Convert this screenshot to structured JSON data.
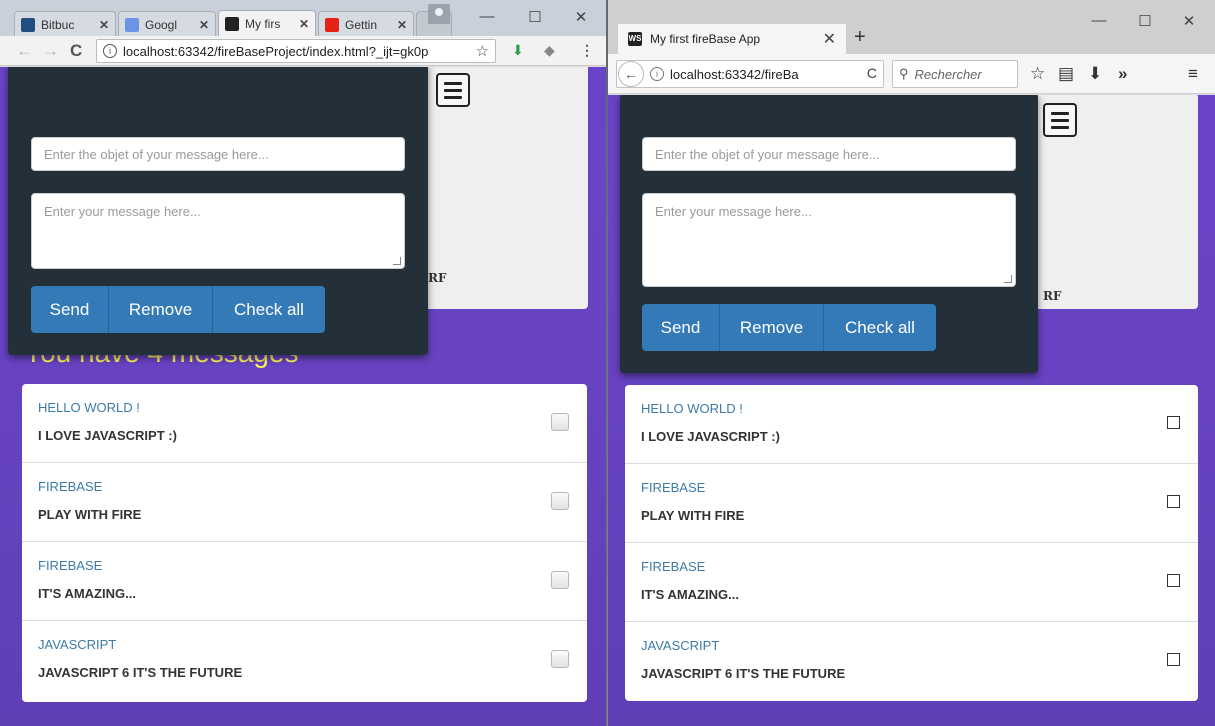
{
  "chrome": {
    "tabs": [
      {
        "label": "Bitbuc",
        "icon": "bitbucket-icon"
      },
      {
        "label": "Googl",
        "icon": "google-icon"
      },
      {
        "label": "My firs",
        "icon": "webstorm-icon"
      },
      {
        "label": "Gettin",
        "icon": "youtube-icon"
      }
    ],
    "url": "localhost:63342/fireBaseProject/index.html?_ijt=gk0p"
  },
  "firefox": {
    "tab_title": "My first fireBase App",
    "url": "localhost:63342/fireBa",
    "search_placeholder": "Rechercher"
  },
  "app": {
    "object_placeholder": "Enter the objet of your message here...",
    "message_placeholder": "Enter your message here...",
    "send_label": "Send",
    "remove_label": "Remove",
    "check_all_label": "Check all",
    "header_fragment": "RF",
    "count_title": "You have 4 messages",
    "messages": [
      {
        "subject": "HELLO WORLD !",
        "body": "I LOVE JAVASCRIPT :)"
      },
      {
        "subject": "FIREBASE",
        "body": "PLAY WITH FIRE"
      },
      {
        "subject": "FIREBASE",
        "body": "IT'S AMAZING..."
      },
      {
        "subject": "JAVASCRIPT",
        "body": "JAVASCRIPT 6 IT'S THE FUTURE"
      }
    ]
  },
  "colors": {
    "page_bg": "#6743c2",
    "panel_bg": "#243039",
    "button": "#337ab7",
    "title": "#fff35a",
    "subject": "#3d7ba6"
  }
}
